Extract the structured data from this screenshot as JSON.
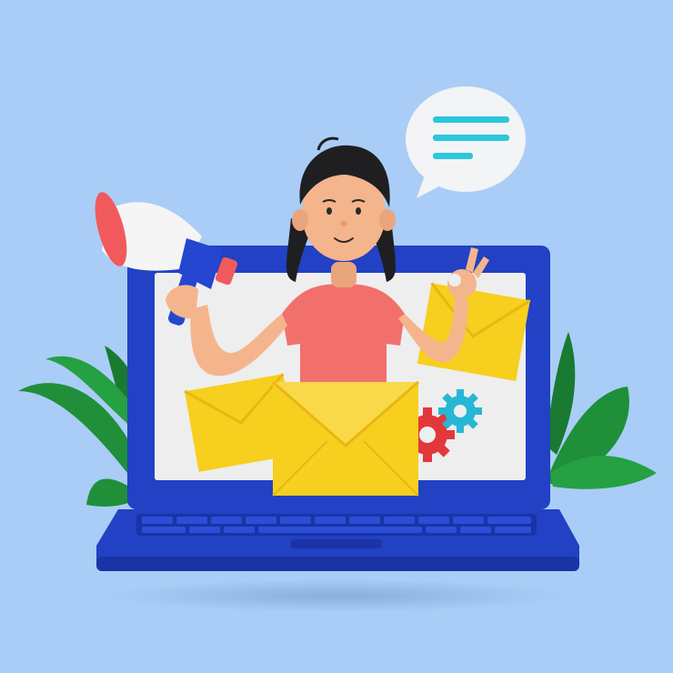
{
  "scene": {
    "colors": {
      "background": "#a9cdf6",
      "laptop_blue": "#2241c4",
      "laptop_dark": "#1a34a6",
      "screen": "#eeeeef",
      "envelope": "#f7cf1e",
      "envelope_shade": "#e7b810",
      "shirt": "#f2706b",
      "skin": "#f4b58d",
      "hair": "#1f1f22",
      "leaf": "#1f8f3a",
      "gear_red": "#e3383b",
      "gear_cyan": "#27b7d6",
      "bubble": "#f3f4f6",
      "bubble_lines": "#2cc7dd",
      "megaphone_white": "#f5f5f5",
      "megaphone_red": "#f05a5c",
      "megaphone_handle": "#2446d0"
    },
    "elements": [
      "laptop",
      "woman",
      "megaphone",
      "envelopes",
      "gears",
      "speech-bubble",
      "plants"
    ]
  }
}
